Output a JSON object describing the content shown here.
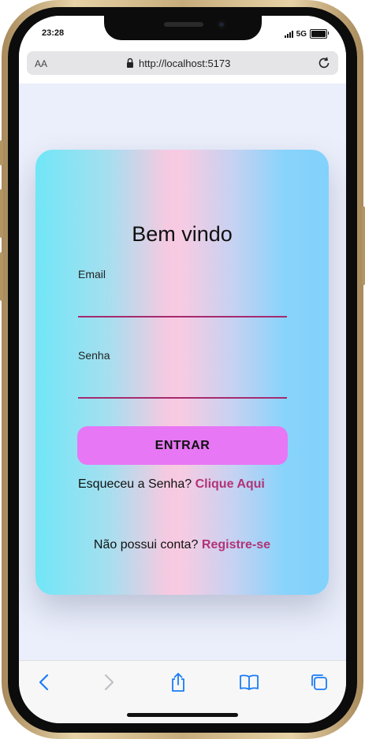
{
  "status_bar": {
    "time": "23:28",
    "network": "5G"
  },
  "browser": {
    "text_size_label": "AA",
    "url": "http://localhost:5173",
    "icons": [
      "lock-icon",
      "reload-icon"
    ]
  },
  "login_card": {
    "title": "Bem vindo",
    "email_label": "Email",
    "email_value": "",
    "password_label": "Senha",
    "password_value": "",
    "submit_label": "ENTRAR",
    "forgot_text": "Esqueceu a Senha?",
    "forgot_link": "Clique Aqui",
    "register_text": "Não possui conta?",
    "register_link": "Registre-se"
  },
  "toolbar": {
    "icons": [
      "back-icon",
      "forward-icon",
      "share-icon",
      "bookmarks-icon",
      "tabs-icon"
    ]
  },
  "colors": {
    "accent_button": "#e777f5",
    "link": "#b23377",
    "input_underline": "#a52a6e",
    "ios_blue": "#1a7cf5"
  }
}
